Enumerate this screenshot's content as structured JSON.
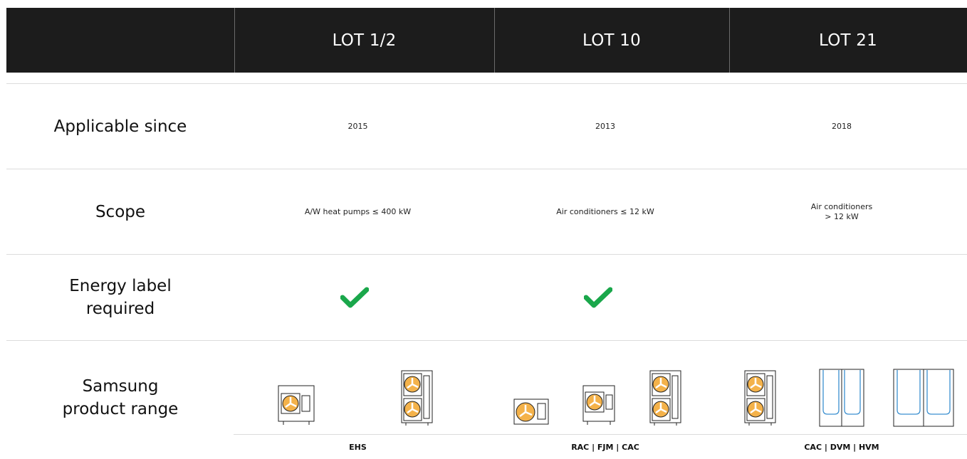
{
  "header": {
    "columns": [
      "LOT 1/2",
      "LOT 10",
      "LOT 21"
    ]
  },
  "rows": {
    "applicable": {
      "label": "Applicable since",
      "values": [
        "2015",
        "2013",
        "2018"
      ]
    },
    "scope": {
      "label": "Scope",
      "values": [
        "A/W heat pumps ≤ 400 kW",
        "Air conditioners ≤ 12 kW"
      ],
      "lot21_line1": "Air conditioners",
      "lot21_line2": "> 12 kW"
    },
    "energy": {
      "label_line1": "Energy label",
      "label_line2": "required",
      "required": [
        true,
        true,
        false
      ],
      "check_icon_color": "#1aa74b"
    },
    "products": {
      "label_line1": "Samsung",
      "label_line2": "product range",
      "categories": [
        "EHS",
        "RAC | FJM | CAC",
        "CAC | DVM | HVM"
      ],
      "fan_color": "#f4b24a",
      "accent_blue": "#3a8fd0"
    }
  }
}
